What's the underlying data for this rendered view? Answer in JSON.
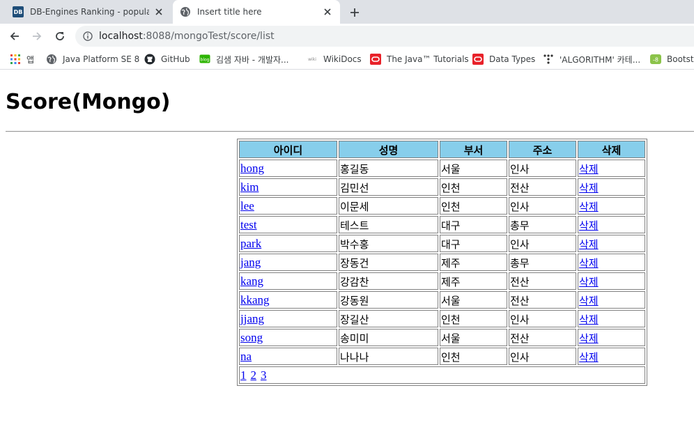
{
  "browser": {
    "tabs": [
      {
        "title": "DB-Engines Ranking - popularity",
        "favicon": "DB",
        "active": false
      },
      {
        "title": "Insert title here",
        "active": true
      }
    ],
    "new_tab_icon": "plus-icon",
    "url_host": "localhost",
    "url_rest": ":8088/mongoTest/score/list",
    "bookmarks": [
      {
        "label": "앱",
        "icon": "apps-grid-icon"
      },
      {
        "label": "Java Platform SE 8",
        "icon": "globe-icon"
      },
      {
        "label": "GitHub",
        "icon": "github-icon"
      },
      {
        "label": "김샘 자바 - 개발자...",
        "icon": "blog-icon"
      },
      {
        "label": "WikiDocs",
        "icon": "wikidocs-icon"
      },
      {
        "label": "The Java™ Tutorials",
        "icon": "oracle-icon"
      },
      {
        "label": "Data Types",
        "icon": "oracle-icon"
      },
      {
        "label": "'ALGORITHM' 카테...",
        "icon": "dots-icon"
      },
      {
        "label": "Bootstra",
        "icon": "bootstrap-icon"
      }
    ]
  },
  "page": {
    "title": "Score(Mongo)",
    "table": {
      "headers": [
        "아이디",
        "성명",
        "부서",
        "주소",
        "삭제"
      ],
      "rows": [
        {
          "id": "hong",
          "name": "홍길동",
          "dept": "서울",
          "addr": "인사",
          "delete": "삭제"
        },
        {
          "id": "kim",
          "name": "김민선",
          "dept": "인천",
          "addr": "전산",
          "delete": "삭제"
        },
        {
          "id": "lee",
          "name": "이문세",
          "dept": "인천",
          "addr": "인사",
          "delete": "삭제"
        },
        {
          "id": "test",
          "name": "테스트",
          "dept": "대구",
          "addr": "총무",
          "delete": "삭제"
        },
        {
          "id": "park",
          "name": "박수홍",
          "dept": "대구",
          "addr": "인사",
          "delete": "삭제"
        },
        {
          "id": "jang",
          "name": "장동건",
          "dept": "제주",
          "addr": "총무",
          "delete": "삭제"
        },
        {
          "id": "kang",
          "name": "강감찬",
          "dept": "제주",
          "addr": "전산",
          "delete": "삭제"
        },
        {
          "id": "kkang",
          "name": "강동원",
          "dept": "서울",
          "addr": "전산",
          "delete": "삭제"
        },
        {
          "id": "jjang",
          "name": "장길산",
          "dept": "인천",
          "addr": "인사",
          "delete": "삭제"
        },
        {
          "id": "song",
          "name": "송미미",
          "dept": "서울",
          "addr": "전산",
          "delete": "삭제"
        },
        {
          "id": "na",
          "name": "나나나",
          "dept": "인천",
          "addr": "인사",
          "delete": "삭제"
        }
      ],
      "pages": [
        "1",
        "2",
        "3"
      ],
      "header_color": "#87ceeb",
      "link_color": "#0000ee"
    }
  }
}
